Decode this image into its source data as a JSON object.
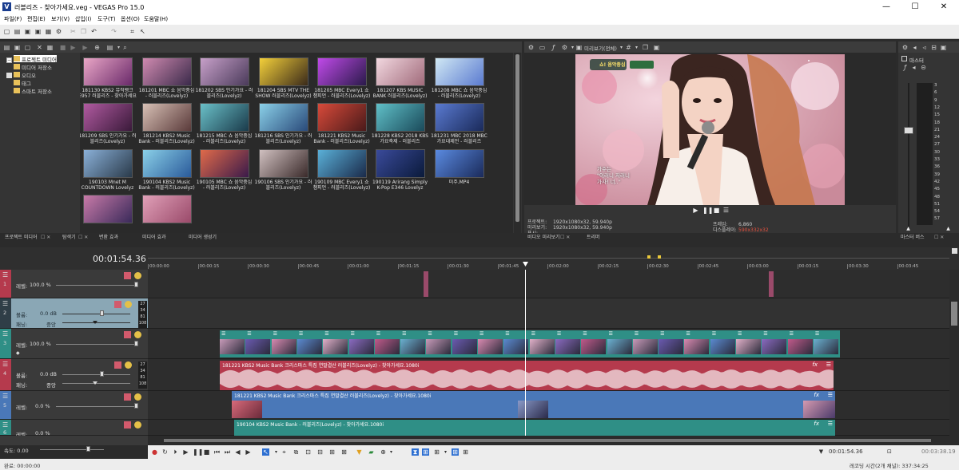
{
  "window": {
    "title": "러블리즈 - 찾아가세요.veg - VEGAS Pro 15.0",
    "app_initial": "V",
    "minimize": "—",
    "maximize": "☐",
    "close": "✕"
  },
  "menu": [
    "파일(F)",
    "편집(E)",
    "보기(V)",
    "삽입(I)",
    "도구(T)",
    "옵션(O)",
    "도움말(H)"
  ],
  "explorer": {
    "tree": [
      "프로젝트 미디어",
      "미디어 저장소",
      "모든 미디어",
      "스마트 저장소"
    ],
    "tree_sub": [
      "모든 미디어",
      "오디오",
      "태그"
    ],
    "thumbs": [
      "181130 KBS2 뮤직뱅크 E957 러블리즈 - 찾아가세요",
      "181201 MBC 쇼 음악중심 - 러블리즈(Lovelyz)",
      "181202 SBS 인기가요 - 러블리즈(Lovelyz)",
      "181204 SBS MTV THE SHOW 러블리즈(Lovelyz)",
      "181205 MBC Every1 쇼 챔피언 - 러블리즈(Lovelyz)",
      "181207 KBS MUSIC BANK 러블리즈(Lovelyz)",
      "181208 MBC 쇼 음악중심 - 러블리즈(Lovelyz)",
      "181209 SBS 인기가요 - 러블리즈(Lovelyz)",
      "181214 KBS2 Music Bank - 러블리즈(Lovelyz)",
      "181215 MBC 쇼 음악중심 - 러블리즈(Lovelyz)",
      "181216 SBS 인기가요 - 러블리즈(Lovelyz)",
      "181221 KBS2 Music Bank - 러블리즈(Lovelyz)",
      "181228 KBS2 2018 KBS가요축제 - 러블리즈",
      "181231 MBC 2018 MBC 가요대제전 - 러블리즈",
      "190103 Mnet M COUNTDOWN Lovelyz",
      "190104 KBS2 Music Bank - 러블리즈(Lovelyz)",
      "190105 MBC 쇼 음악중심 - 러블리즈(Lovelyz)",
      "190106 SBS 인기가요 - 러블리즈(Lovelyz)",
      "190109 MBC Every1 쇼 챔피언 - 러블리즈(Lovelyz)",
      "190119 Arirang Simply K-Pop E346 Lovelyz",
      "미주.MP4",
      "",
      ""
    ],
    "tabs": [
      "프로젝트 미디어",
      "탐색기",
      "변환 효과",
      "미디어 효과",
      "미디어 생성기"
    ]
  },
  "preview": {
    "toolbar_label": "미리보기(전체)",
    "info_left_labels": [
      "프로젝트:",
      "미리보기:",
      "표시:"
    ],
    "info_left_values": [
      "1920x1080x32, 59.940p",
      "1920x1080x32, 59.940p",
      ""
    ],
    "info_right_labels": [
      "프레임:",
      "디스플레이:"
    ],
    "info_right_values": [
      "6,860",
      "590x332x32"
    ],
    "caption_lines": [
      "가수는",
      "\"이러니 저러니",
      "가사! 너..\""
    ],
    "show_logo": "쇼! 음악중심",
    "tabs": [
      "비디오 미리보기",
      "트리머"
    ]
  },
  "meter": {
    "title": "마스터",
    "scale": [
      "3",
      "6",
      "9",
      "12",
      "15",
      "18",
      "21",
      "24",
      "27",
      "30",
      "33",
      "36",
      "39",
      "42",
      "45",
      "48",
      "51",
      "54",
      "57"
    ],
    "bottom": [
      "0.0",
      "0.0"
    ],
    "tab": "마스터 버스"
  },
  "timeline": {
    "timecode": "00:01:54.36",
    "ruler": [
      "00:00:00",
      "00:00:15",
      "00:00:30",
      "00:00:45",
      "00:01:00",
      "00:01:15",
      "00:01:30",
      "00:01:45",
      "00:02:00",
      "00:02:15",
      "00:02:30",
      "00:02:45",
      "00:03:00",
      "00:03:15",
      "00:03:30",
      "00:03:45"
    ],
    "playhead_fraction": 0.4706
  },
  "tracks": [
    {
      "kind": "video",
      "number": "1",
      "level_label": "레벨:",
      "level": "100.0 %"
    },
    {
      "kind": "audio",
      "number": "2",
      "vol_label": "볼륨:",
      "vol": "0.0 dB",
      "pan_label": "패닝:",
      "pan": "중앙"
    },
    {
      "kind": "video",
      "number": "3",
      "level_label": "레벨:",
      "level": "100.0 %"
    },
    {
      "kind": "audio",
      "number": "4",
      "vol_label": "볼륨:",
      "vol": "0.0 dB",
      "pan_label": "패닝:",
      "pan": "중앙"
    },
    {
      "kind": "video",
      "number": "5",
      "level_label": "레벨:",
      "level": "0.0 %"
    },
    {
      "kind": "video",
      "number": "6",
      "level_label": "레벨:",
      "level": "0.0 %"
    }
  ],
  "clips": {
    "audio_main": "181221 KBS2 Music Bank 크리스마스 특집 연말결산 러블리즈(Lovelyz) - 찾아가세요.1080i",
    "video_blue": "181221 KBS2 Music Bank 크리스마스 특집 연말결산 러블리즈(Lovelyz) - 찾아가세요.1080i",
    "video_green": "190104 KBS2 Music Bank - 러블리즈(Lovelyz) - 찾아가세요.1080i",
    "fx": "fx"
  },
  "meter_ticks_left": [
    "27",
    "34",
    "81",
    "108"
  ],
  "meter_ticks_left2": [
    "27",
    "34",
    "81",
    "108"
  ],
  "transport": {
    "timecode": "00:01:54.36",
    "end": "00:03:38.19"
  },
  "status": {
    "left": "완료: 00:00:00",
    "rate_label": "속도: 0.00",
    "right": "레코딩 시간(2개 채널): 337:34:25"
  }
}
